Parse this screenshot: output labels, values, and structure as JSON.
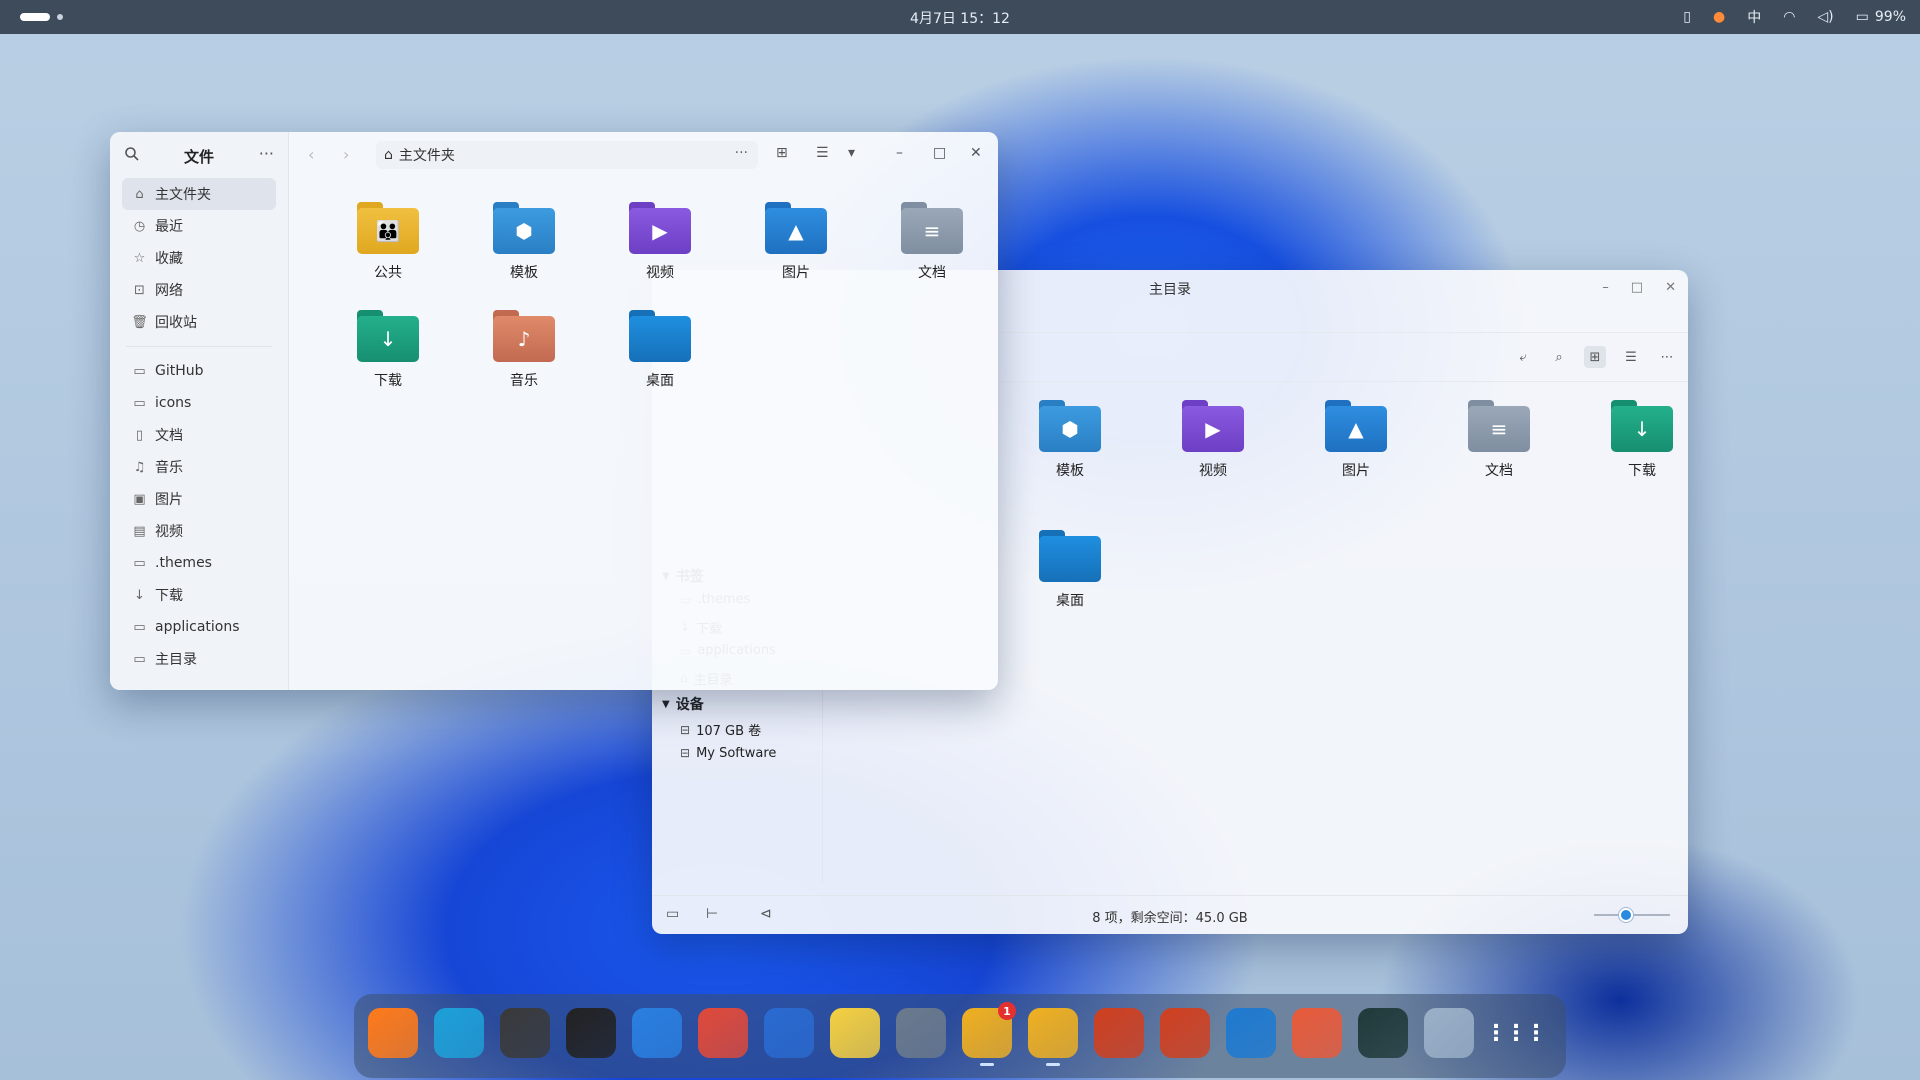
{
  "topbar": {
    "clock": "4月7日 15：12",
    "ime": "中",
    "battery": "99%"
  },
  "win1": {
    "sidebar_title": "文件",
    "more": "···",
    "nav": [
      {
        "label": "主文件夹",
        "icon": "⌂",
        "active": true
      },
      {
        "label": "最近",
        "icon": "◷"
      },
      {
        "label": "收藏",
        "icon": "☆"
      },
      {
        "label": "网络",
        "icon": "⊡"
      },
      {
        "label": "回收站",
        "icon": "🗑"
      }
    ],
    "bookmarks": [
      {
        "label": "GitHub",
        "icon": "▭"
      },
      {
        "label": "icons",
        "icon": "▭"
      },
      {
        "label": "文档",
        "icon": "▯"
      },
      {
        "label": "音乐",
        "icon": "♫"
      },
      {
        "label": "图片",
        "icon": "▣"
      },
      {
        "label": "视频",
        "icon": "▤"
      },
      {
        "label": ".themes",
        "icon": "▭"
      },
      {
        "label": "下载",
        "icon": "↓"
      },
      {
        "label": "applications",
        "icon": "▭"
      },
      {
        "label": "主目录",
        "icon": "▭"
      }
    ],
    "path": "主文件夹",
    "path_more": "···",
    "files": [
      {
        "label": "公共",
        "color": "#f0c040",
        "tab": "#e0a820",
        "glyph": "👪"
      },
      {
        "label": "模板",
        "color": "#3d9be0",
        "tab": "#2a7fc4",
        "glyph": "⬢"
      },
      {
        "label": "视频",
        "color": "#8a5ae0",
        "tab": "#6d3fc4",
        "glyph": "▶"
      },
      {
        "label": "图片",
        "color": "#2f8ee0",
        "tab": "#1f70c0",
        "glyph": "▲"
      },
      {
        "label": "文档",
        "color": "#9aa8b8",
        "tab": "#7f8ea0",
        "glyph": "≡"
      },
      {
        "label": "下载",
        "color": "#24b08c",
        "tab": "#168f70",
        "glyph": "↓"
      },
      {
        "label": "音乐",
        "color": "#e08a6a",
        "tab": "#c26a50",
        "glyph": "♪"
      },
      {
        "label": "桌面",
        "color": "#1f8fe0",
        "tab": "#1670b8",
        "glyph": ""
      }
    ]
  },
  "win2": {
    "title": "主目录",
    "sections": [
      {
        "label": "书签",
        "items": [
          {
            "label": ".themes",
            "icon": "▭"
          },
          {
            "label": "下载",
            "icon": "↓"
          },
          {
            "label": "applications",
            "icon": "▭"
          },
          {
            "label": "主目录",
            "icon": "⌂"
          }
        ]
      },
      {
        "label": "设备",
        "items": [
          {
            "label": "107 GB 卷",
            "icon": "⊟"
          },
          {
            "label": "My Software",
            "icon": "⊟"
          }
        ]
      }
    ],
    "files": [
      {
        "label": "模板",
        "color": "#3d9be0",
        "tab": "#2a7fc4",
        "glyph": "⬢"
      },
      {
        "label": "视频",
        "color": "#8a5ae0",
        "tab": "#6d3fc4",
        "glyph": "▶"
      },
      {
        "label": "图片",
        "color": "#2f8ee0",
        "tab": "#1f70c0",
        "glyph": "▲"
      },
      {
        "label": "文档",
        "color": "#9aa8b8",
        "tab": "#7f8ea0",
        "glyph": "≡"
      },
      {
        "label": "下载",
        "color": "#24b08c",
        "tab": "#168f70",
        "glyph": "↓"
      },
      {
        "label": "桌面",
        "color": "#1f8fe0",
        "tab": "#1670b8",
        "glyph": ""
      }
    ],
    "status": "8 项，剩余空间：45.0 GB",
    "zoom_fraction": 0.4
  },
  "dock": {
    "apps": [
      {
        "name": "firefox-icon",
        "color": "#ff7a1a",
        "glyph": ""
      },
      {
        "name": "edge-icon",
        "color": "#1ea0d8",
        "glyph": ""
      },
      {
        "name": "inkscape-icon",
        "color": "#3a3a3a",
        "glyph": ""
      },
      {
        "name": "github-icon",
        "color": "#222222",
        "glyph": ""
      },
      {
        "name": "calendar-icon",
        "color": "#2a7fe0",
        "glyph": ""
      },
      {
        "name": "music-player-icon",
        "color": "#e04a3a",
        "glyph": ""
      },
      {
        "name": "app-store-icon",
        "color": "#2a6ad0",
        "glyph": ""
      },
      {
        "name": "text-editor-icon",
        "color": "#f5d040",
        "glyph": ""
      },
      {
        "name": "settings-icon",
        "color": "#6b7a8c",
        "glyph": ""
      },
      {
        "name": "file-manager-icon",
        "color": "#f0b020",
        "glyph": "",
        "badge": "1",
        "running": true
      },
      {
        "name": "file-manager-2-icon",
        "color": "#f0b020",
        "glyph": "",
        "running": true
      },
      {
        "name": "monitor-icon",
        "color": "#d04020",
        "glyph": ""
      },
      {
        "name": "monitor-2-icon",
        "color": "#d04020",
        "glyph": ""
      },
      {
        "name": "vscode-icon",
        "color": "#1e7ad0",
        "glyph": ""
      },
      {
        "name": "git-icon",
        "color": "#e85a3a",
        "glyph": ""
      },
      {
        "name": "system-monitor-icon",
        "color": "#1f3a3a",
        "glyph": ""
      },
      {
        "name": "trash-icon",
        "color": "#9ab0c8",
        "glyph": ""
      },
      {
        "name": "app-grid-icon",
        "color": "#00000000",
        "glyph": "⋮⋮⋮"
      }
    ]
  }
}
